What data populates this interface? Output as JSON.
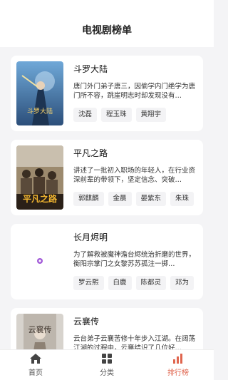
{
  "header": {
    "title": "电视剧榜单"
  },
  "shows": [
    {
      "name": "斗罗大陆",
      "desc": "唐门外门弟子唐三，因偷学内门绝学为唐门所不容，跳崖明志时却发现没有…",
      "cast": [
        "沈磊",
        "程玉珠",
        "黄翔宇"
      ],
      "poster_caption": "斗罗大陆"
    },
    {
      "name": "平凡之路",
      "desc": "讲述了一批初入职场的年轻人，在行业资深前辈的带领下，坚定信念、突破…",
      "cast": [
        "郭麒麟",
        "金晨",
        "晏紫东",
        "朱珠"
      ],
      "poster_caption": "平凡之路"
    },
    {
      "name": "长月烬明",
      "desc": "为了解救被魔神澹台烬统治折磨的世界，衡阳宗掌门之女黎苏苏孤注一掷…",
      "cast": [
        "罗云熙",
        "白鹿",
        "陈都灵",
        "邓为"
      ],
      "poster_caption": ""
    },
    {
      "name": "云襄传",
      "desc": "云台弟子云襄苦修十年步入江湖。在阔荡江湖的过程中，云襄结识了几位好…",
      "cast": [],
      "poster_caption": "云襄传"
    }
  ],
  "tabbar": {
    "tabs": [
      {
        "label": "首页",
        "icon": "home-icon"
      },
      {
        "label": "分类",
        "icon": "grid-icon"
      },
      {
        "label": "排行榜",
        "icon": "ranking-icon"
      }
    ],
    "active_color": "#e0664f"
  }
}
